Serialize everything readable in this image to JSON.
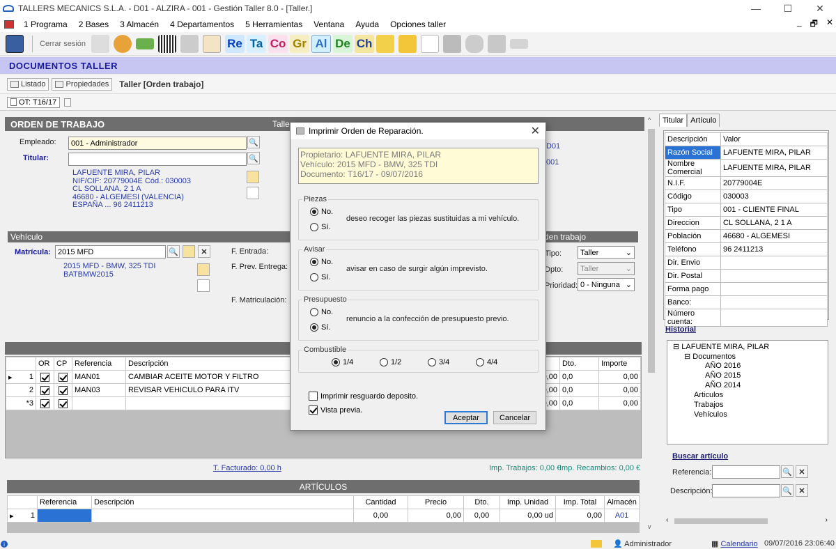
{
  "window": {
    "title": "TALLERS MECANICS S.L.A. - D01 - ALZIRA - 001 - Gestión Taller 8.0 - [Taller.]",
    "minimize": "—",
    "maximize": "☐",
    "close": "✕"
  },
  "menu": {
    "items": [
      "1 Programa",
      "2 Bases",
      "3 Almacén",
      "4 Departamentos",
      "5 Herramientas",
      "Ventana",
      "Ayuda",
      "Opciones taller"
    ],
    "mdi": [
      "_",
      "🗗",
      "✕"
    ]
  },
  "toolbar": {
    "cerrar_sesion": "Cerrar sesión",
    "letters": [
      "Re",
      "Ta",
      "Co",
      "Gr",
      "Al",
      "De",
      "Ch"
    ]
  },
  "doc_header": "DOCUMENTOS TALLER",
  "subbar": {
    "listado": "Listado",
    "propiedades": "Propiedades",
    "caption": "Taller [Orden trabajo]"
  },
  "doc_tab": "OT: T16/17",
  "orden": {
    "title": "ORDEN DE TRABAJO",
    "taller_label": "Talle",
    "empleado_label": "Empleado:",
    "empleado_value": "001 - Administrador",
    "titular_label": "Titular:",
    "titular_value": "",
    "address": [
      "LAFUENTE MIRA, PILAR",
      "NIF/CIF: 20779004E   Cód.: 030003",
      "CL SOLLANA, 2 1 A",
      "46680 - ALGEMESI (VALENCIA)",
      "ESPAÑA ... 96 2411213"
    ],
    "right_codes": [
      "D01",
      "001"
    ]
  },
  "vehiculo": {
    "title": "Vehículo",
    "matricula_label": "Matrícula:",
    "matricula_value": "2015 MFD",
    "desc": [
      "2015 MFD - BMW, 325 TDI",
      "BATBMW2015"
    ],
    "f_entrada": "F. Entrada:",
    "f_prev": "F. Prev. Entrega:",
    "f_matric": "F. Matriculación:"
  },
  "orden_trabajo_side": {
    "title": "rden trabajo",
    "tipo_label": "Tipo:",
    "tipo_value": "Taller",
    "dpto_label": "Dpto:",
    "dpto_value": "Taller",
    "prioridad_label": "Prioridad:",
    "prioridad_value": "0 - Ninguna"
  },
  "trabajos": {
    "headers": [
      "OR",
      "CP",
      "Referencia",
      "Descripción"
    ],
    "right_headers": [
      "o",
      "Dto.",
      "Importe"
    ],
    "rows": [
      {
        "num": "1",
        "ref": "MAN01",
        "desc": "CAMBIAR ACEITE MOTOR Y FILTRO",
        "p": "50,00",
        "dto": "0,0",
        "imp": "0,00"
      },
      {
        "num": "2",
        "ref": "MAN03",
        "desc": "REVISAR VEHICULO PARA ITV",
        "p": "50,00",
        "dto": "0,0",
        "imp": "0,00"
      },
      {
        "num": "*3",
        "ref": "",
        "desc": "",
        "p": "00,00",
        "dto": "0,0",
        "imp": "0,00"
      }
    ],
    "t_facturado": "T. Facturado: 0,00 h",
    "imp_trabajos": "Imp. Trabajos: 0,00 €",
    "imp_recambios": "Imp. Recambios: 0,00 €"
  },
  "articulos": {
    "title": "ARTÍCULOS",
    "headers": [
      "Referencia",
      "Descripción",
      "Cantidad",
      "Precio",
      "Dto.",
      "Imp. Unidad",
      "Imp. Total",
      "Almacén"
    ],
    "row": {
      "num": "1",
      "cantidad": "0,00",
      "precio": "0,00",
      "dto": "0,00",
      "imp_unidad": "0,00 ud",
      "imp_total": "0,00",
      "almacen": "A01"
    }
  },
  "right_panel": {
    "tabs": [
      "Titular",
      "Artículo"
    ],
    "headers": [
      "Descripción",
      "Valor"
    ],
    "rows": [
      [
        "Razón Social",
        "LAFUENTE MIRA, PILAR"
      ],
      [
        "Nombre Comercial",
        "LAFUENTE MIRA, PILAR"
      ],
      [
        "N.I.F.",
        "20779004E"
      ],
      [
        "Código",
        "030003"
      ],
      [
        "Tipo",
        "001 - CLIENTE FINAL"
      ],
      [
        "Direccion",
        "CL SOLLANA, 2 1 A"
      ],
      [
        "Población",
        "46680 - ALGEMESI"
      ],
      [
        "Teléfono",
        "96 2411213"
      ],
      [
        "Dir. Envio",
        ""
      ],
      [
        "Dir. Postal",
        ""
      ],
      [
        "Forma pago",
        ""
      ],
      [
        "Banco:",
        ""
      ],
      [
        "Número cuenta:",
        ""
      ]
    ],
    "historial": "Historial",
    "tree": [
      "LAFUENTE MIRA, PILAR",
      "Documentos",
      "AÑO 2016",
      "AÑO 2015",
      "AÑO 2014",
      "Articulos",
      "Trabajos",
      "Vehículos"
    ],
    "buscar": "Buscar artículo",
    "referencia_label": "Referencia:",
    "descripcion_label": "Descripción:"
  },
  "dialog": {
    "title": "Imprimir Orden de Reparación.",
    "info": [
      "Propietario: LAFUENTE MIRA, PILAR",
      "Vehículo: 2015 MFD - BMW, 325 TDI",
      "Documento: T16/17 - 09/07/2016"
    ],
    "piezas": {
      "title": "Piezas",
      "no": "No.",
      "si": "Sí.",
      "text": "deseo recoger las piezas sustituidas a mi vehículo."
    },
    "avisar": {
      "title": "Avisar",
      "no": "No.",
      "si": "Sí.",
      "text": "avisar en caso de surgir algún imprevisto."
    },
    "presupuesto": {
      "title": "Presupuesto",
      "no": "No.",
      "si": "Sí.",
      "text": "renuncio a la confección de presupuesto previo."
    },
    "combustible": {
      "title": "Combustible",
      "options": [
        "1/4",
        "1/2",
        "3/4",
        "4/4"
      ]
    },
    "resguardo": "Imprimir resguardo deposito.",
    "vista_previa": "Vista previa.",
    "aceptar": "Aceptar",
    "cancelar": "Cancelar"
  },
  "status": {
    "user": "Administrador",
    "calendario": "Calendario",
    "datetime": "09/07/2016 23:06:40"
  }
}
